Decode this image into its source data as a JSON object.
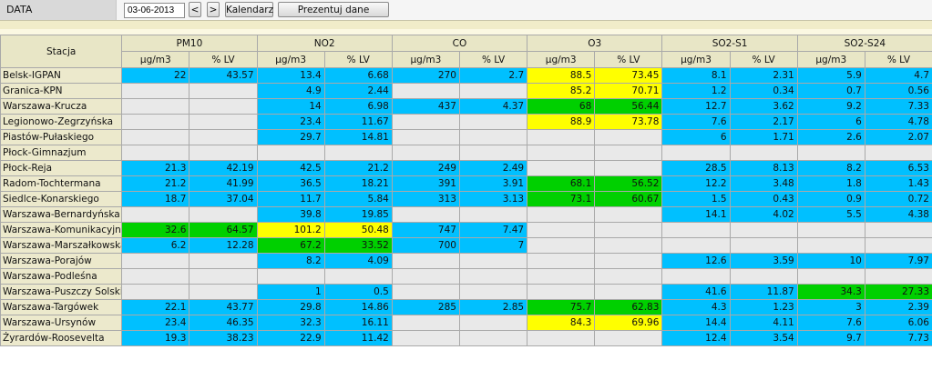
{
  "header": {
    "data_label": "DATA",
    "date_value": "03-06-2013",
    "prev_button": "<",
    "next_button": ">",
    "calendar_button": "Kalendarz",
    "present_button": "Prezentuj dane"
  },
  "table": {
    "station_header": "Stacja",
    "pollutants": [
      "PM10",
      "NO2",
      "CO",
      "O3",
      "SO2-S1",
      "SO2-S24"
    ],
    "units": [
      "µg/m3",
      "% LV",
      "µg/m3",
      "% LV",
      "µg/m3",
      "% LV",
      "µg/m3",
      "% LV",
      "µg/m3",
      "% LV",
      "µg/m3",
      "% LV"
    ],
    "status_colors": {
      "g": "#e9e9e9",
      "b": "#00c0ff",
      "y": "#ffff00",
      "gr": "#00d000"
    },
    "rows": [
      {
        "station": "Belsk-IGPAN",
        "cells": [
          [
            "22",
            "b"
          ],
          [
            "43.57",
            "b"
          ],
          [
            "13.4",
            "b"
          ],
          [
            "6.68",
            "b"
          ],
          [
            "270",
            "b"
          ],
          [
            "2.7",
            "b"
          ],
          [
            "88.5",
            "y"
          ],
          [
            "73.45",
            "y"
          ],
          [
            "8.1",
            "b"
          ],
          [
            "2.31",
            "b"
          ],
          [
            "5.9",
            "b"
          ],
          [
            "4.7",
            "b"
          ]
        ]
      },
      {
        "station": "Granica-KPN",
        "cells": [
          [
            "",
            "g"
          ],
          [
            "",
            "g"
          ],
          [
            "4.9",
            "b"
          ],
          [
            "2.44",
            "b"
          ],
          [
            "",
            "g"
          ],
          [
            "",
            "g"
          ],
          [
            "85.2",
            "y"
          ],
          [
            "70.71",
            "y"
          ],
          [
            "1.2",
            "b"
          ],
          [
            "0.34",
            "b"
          ],
          [
            "0.7",
            "b"
          ],
          [
            "0.56",
            "b"
          ]
        ]
      },
      {
        "station": "Warszawa-Krucza",
        "cells": [
          [
            "",
            "g"
          ],
          [
            "",
            "g"
          ],
          [
            "14",
            "b"
          ],
          [
            "6.98",
            "b"
          ],
          [
            "437",
            "b"
          ],
          [
            "4.37",
            "b"
          ],
          [
            "68",
            "gr"
          ],
          [
            "56.44",
            "gr"
          ],
          [
            "12.7",
            "b"
          ],
          [
            "3.62",
            "b"
          ],
          [
            "9.2",
            "b"
          ],
          [
            "7.33",
            "b"
          ]
        ]
      },
      {
        "station": "Legionowo-Zegrzyńska",
        "cells": [
          [
            "",
            "g"
          ],
          [
            "",
            "g"
          ],
          [
            "23.4",
            "b"
          ],
          [
            "11.67",
            "b"
          ],
          [
            "",
            "g"
          ],
          [
            "",
            "g"
          ],
          [
            "88.9",
            "y"
          ],
          [
            "73.78",
            "y"
          ],
          [
            "7.6",
            "b"
          ],
          [
            "2.17",
            "b"
          ],
          [
            "6",
            "b"
          ],
          [
            "4.78",
            "b"
          ]
        ]
      },
      {
        "station": "Piastów-Pułaskiego",
        "cells": [
          [
            "",
            "g"
          ],
          [
            "",
            "g"
          ],
          [
            "29.7",
            "b"
          ],
          [
            "14.81",
            "b"
          ],
          [
            "",
            "g"
          ],
          [
            "",
            "g"
          ],
          [
            "",
            "g"
          ],
          [
            "",
            "g"
          ],
          [
            "6",
            "b"
          ],
          [
            "1.71",
            "b"
          ],
          [
            "2.6",
            "b"
          ],
          [
            "2.07",
            "b"
          ]
        ]
      },
      {
        "station": "Płock-Gimnazjum",
        "cells": [
          [
            "",
            "g"
          ],
          [
            "",
            "g"
          ],
          [
            "",
            "g"
          ],
          [
            "",
            "g"
          ],
          [
            "",
            "g"
          ],
          [
            "",
            "g"
          ],
          [
            "",
            "g"
          ],
          [
            "",
            "g"
          ],
          [
            "",
            "g"
          ],
          [
            "",
            "g"
          ],
          [
            "",
            "g"
          ],
          [
            "",
            "g"
          ]
        ]
      },
      {
        "station": "Płock-Reja",
        "cells": [
          [
            "21.3",
            "b"
          ],
          [
            "42.19",
            "b"
          ],
          [
            "42.5",
            "b"
          ],
          [
            "21.2",
            "b"
          ],
          [
            "249",
            "b"
          ],
          [
            "2.49",
            "b"
          ],
          [
            "",
            "g"
          ],
          [
            "",
            "g"
          ],
          [
            "28.5",
            "b"
          ],
          [
            "8.13",
            "b"
          ],
          [
            "8.2",
            "b"
          ],
          [
            "6.53",
            "b"
          ]
        ]
      },
      {
        "station": "Radom-Tochtermana",
        "cells": [
          [
            "21.2",
            "b"
          ],
          [
            "41.99",
            "b"
          ],
          [
            "36.5",
            "b"
          ],
          [
            "18.21",
            "b"
          ],
          [
            "391",
            "b"
          ],
          [
            "3.91",
            "b"
          ],
          [
            "68.1",
            "gr"
          ],
          [
            "56.52",
            "gr"
          ],
          [
            "12.2",
            "b"
          ],
          [
            "3.48",
            "b"
          ],
          [
            "1.8",
            "b"
          ],
          [
            "1.43",
            "b"
          ]
        ]
      },
      {
        "station": "Siedlce-Konarskiego",
        "cells": [
          [
            "18.7",
            "b"
          ],
          [
            "37.04",
            "b"
          ],
          [
            "11.7",
            "b"
          ],
          [
            "5.84",
            "b"
          ],
          [
            "313",
            "b"
          ],
          [
            "3.13",
            "b"
          ],
          [
            "73.1",
            "gr"
          ],
          [
            "60.67",
            "gr"
          ],
          [
            "1.5",
            "b"
          ],
          [
            "0.43",
            "b"
          ],
          [
            "0.9",
            "b"
          ],
          [
            "0.72",
            "b"
          ]
        ]
      },
      {
        "station": "Warszawa-Bernardyńska",
        "cells": [
          [
            "",
            "g"
          ],
          [
            "",
            "g"
          ],
          [
            "39.8",
            "b"
          ],
          [
            "19.85",
            "b"
          ],
          [
            "",
            "g"
          ],
          [
            "",
            "g"
          ],
          [
            "",
            "g"
          ],
          [
            "",
            "g"
          ],
          [
            "14.1",
            "b"
          ],
          [
            "4.02",
            "b"
          ],
          [
            "5.5",
            "b"
          ],
          [
            "4.38",
            "b"
          ]
        ]
      },
      {
        "station": "Warszawa-Komunikacyjna",
        "cells": [
          [
            "32.6",
            "gr"
          ],
          [
            "64.57",
            "gr"
          ],
          [
            "101.2",
            "y"
          ],
          [
            "50.48",
            "y"
          ],
          [
            "747",
            "b"
          ],
          [
            "7.47",
            "b"
          ],
          [
            "",
            "g"
          ],
          [
            "",
            "g"
          ],
          [
            "",
            "g"
          ],
          [
            "",
            "g"
          ],
          [
            "",
            "g"
          ],
          [
            "",
            "g"
          ]
        ]
      },
      {
        "station": "Warszawa-Marszałkowska",
        "cells": [
          [
            "6.2",
            "b"
          ],
          [
            "12.28",
            "b"
          ],
          [
            "67.2",
            "gr"
          ],
          [
            "33.52",
            "gr"
          ],
          [
            "700",
            "b"
          ],
          [
            "7",
            "b"
          ],
          [
            "",
            "g"
          ],
          [
            "",
            "g"
          ],
          [
            "",
            "g"
          ],
          [
            "",
            "g"
          ],
          [
            "",
            "g"
          ],
          [
            "",
            "g"
          ]
        ]
      },
      {
        "station": "Warszawa-Porajów",
        "cells": [
          [
            "",
            "g"
          ],
          [
            "",
            "g"
          ],
          [
            "8.2",
            "b"
          ],
          [
            "4.09",
            "b"
          ],
          [
            "",
            "g"
          ],
          [
            "",
            "g"
          ],
          [
            "",
            "g"
          ],
          [
            "",
            "g"
          ],
          [
            "12.6",
            "b"
          ],
          [
            "3.59",
            "b"
          ],
          [
            "10",
            "b"
          ],
          [
            "7.97",
            "b"
          ]
        ]
      },
      {
        "station": "Warszawa-Podleśna",
        "cells": [
          [
            "",
            "g"
          ],
          [
            "",
            "g"
          ],
          [
            "",
            "g"
          ],
          [
            "",
            "g"
          ],
          [
            "",
            "g"
          ],
          [
            "",
            "g"
          ],
          [
            "",
            "g"
          ],
          [
            "",
            "g"
          ],
          [
            "",
            "g"
          ],
          [
            "",
            "g"
          ],
          [
            "",
            "g"
          ],
          [
            "",
            "g"
          ]
        ]
      },
      {
        "station": "Warszawa-Puszczy Solskiej",
        "cells": [
          [
            "",
            "g"
          ],
          [
            "",
            "g"
          ],
          [
            "1",
            "b"
          ],
          [
            "0.5",
            "b"
          ],
          [
            "",
            "g"
          ],
          [
            "",
            "g"
          ],
          [
            "",
            "g"
          ],
          [
            "",
            "g"
          ],
          [
            "41.6",
            "b"
          ],
          [
            "11.87",
            "b"
          ],
          [
            "34.3",
            "gr"
          ],
          [
            "27.33",
            "gr"
          ]
        ]
      },
      {
        "station": "Warszawa-Targówek",
        "cells": [
          [
            "22.1",
            "b"
          ],
          [
            "43.77",
            "b"
          ],
          [
            "29.8",
            "b"
          ],
          [
            "14.86",
            "b"
          ],
          [
            "285",
            "b"
          ],
          [
            "2.85",
            "b"
          ],
          [
            "75.7",
            "gr"
          ],
          [
            "62.83",
            "gr"
          ],
          [
            "4.3",
            "b"
          ],
          [
            "1.23",
            "b"
          ],
          [
            "3",
            "b"
          ],
          [
            "2.39",
            "b"
          ]
        ]
      },
      {
        "station": "Warszawa-Ursynów",
        "cells": [
          [
            "23.4",
            "b"
          ],
          [
            "46.35",
            "b"
          ],
          [
            "32.3",
            "b"
          ],
          [
            "16.11",
            "b"
          ],
          [
            "",
            "g"
          ],
          [
            "",
            "g"
          ],
          [
            "84.3",
            "y"
          ],
          [
            "69.96",
            "y"
          ],
          [
            "14.4",
            "b"
          ],
          [
            "4.11",
            "b"
          ],
          [
            "7.6",
            "b"
          ],
          [
            "6.06",
            "b"
          ]
        ]
      },
      {
        "station": "Żyrardów-Roosevelta",
        "cells": [
          [
            "19.3",
            "b"
          ],
          [
            "38.23",
            "b"
          ],
          [
            "22.9",
            "b"
          ],
          [
            "11.42",
            "b"
          ],
          [
            "",
            "g"
          ],
          [
            "",
            "g"
          ],
          [
            "",
            "g"
          ],
          [
            "",
            "g"
          ],
          [
            "12.4",
            "b"
          ],
          [
            "3.54",
            "b"
          ],
          [
            "9.7",
            "b"
          ],
          [
            "7.73",
            "b"
          ]
        ]
      }
    ]
  }
}
